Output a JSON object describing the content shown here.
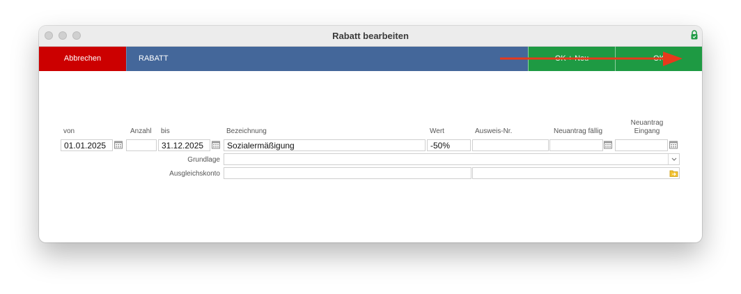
{
  "window": {
    "title": "Rabatt bearbeiten"
  },
  "toolbar": {
    "cancel_label": "Abbrechen",
    "section_label": "RABATT",
    "ok_new_label": "OK + Neu",
    "ok_label": "OK"
  },
  "form": {
    "headers": {
      "von": "von",
      "anzahl": "Anzahl",
      "bis": "bis",
      "bezeichnung": "Bezeichnung",
      "wert": "Wert",
      "ausweis": "Ausweis-Nr.",
      "neuantrag_faellig": "Neuantrag fällig",
      "neuantrag_eingang_1": "Neuantrag",
      "neuantrag_eingang_2": "Eingang"
    },
    "values": {
      "von": "01.01.2025",
      "anzahl": "",
      "bis": "31.12.2025",
      "bezeichnung": "Sozialermäßigung",
      "wert": "-50%",
      "ausweis": "",
      "neuantrag_faellig": "",
      "neuantrag_eingang": ""
    },
    "grundlage_label": "Grundlage",
    "grundlage_value": "",
    "ausgleichskonto_label": "Ausgleichskonto",
    "ausgleichskonto_value": "",
    "ausgleichskonto_value2": ""
  },
  "colors": {
    "cancel": "#cc0000",
    "section": "#44679a",
    "ok": "#1e9a43",
    "arrow": "#e8391c"
  },
  "icons": [
    "lock-icon",
    "calendar-icon",
    "chevron-down-icon",
    "folder-icon",
    "arrow-annotation"
  ]
}
